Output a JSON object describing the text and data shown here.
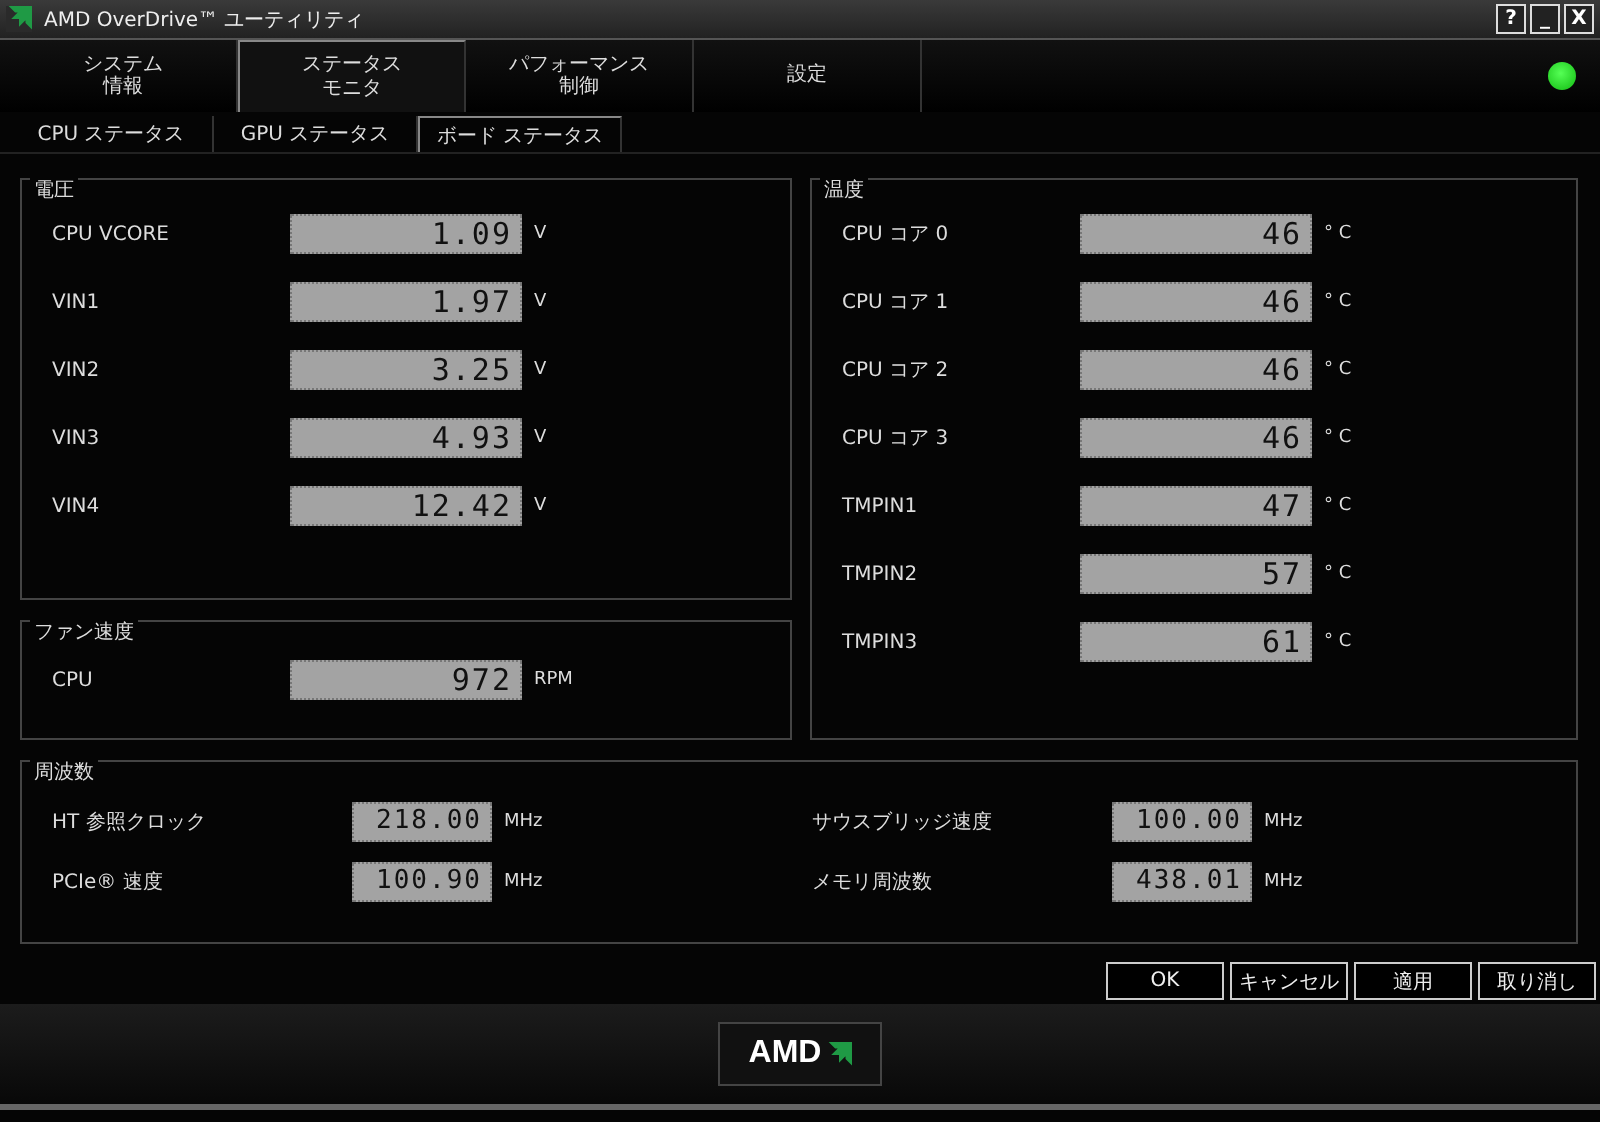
{
  "window": {
    "title": "AMD OverDrive™ ユーティリティ",
    "controls": [
      "?",
      "_",
      "X"
    ]
  },
  "tabs": [
    {
      "lines": [
        "システム",
        "情報"
      ],
      "selected": false
    },
    {
      "lines": [
        "ステータス",
        "モニタ"
      ],
      "selected": true
    },
    {
      "lines": [
        "パフォーマンス",
        "制御"
      ],
      "selected": false
    },
    {
      "lines": [
        "設定"
      ],
      "selected": false
    }
  ],
  "status_light": {
    "on": true
  },
  "subtabs": [
    {
      "label": "CPU ステータス",
      "selected": false
    },
    {
      "label": "GPU ステータス",
      "selected": false
    },
    {
      "label": "ボード ステータス",
      "selected": true
    }
  ],
  "voltage": {
    "title": "電圧",
    "rows": [
      {
        "label": "CPU VCORE",
        "value": "1.09",
        "unit": "V"
      },
      {
        "label": "VIN1",
        "value": "1.97",
        "unit": "V"
      },
      {
        "label": "VIN2",
        "value": "3.25",
        "unit": "V"
      },
      {
        "label": "VIN3",
        "value": "4.93",
        "unit": "V"
      },
      {
        "label": "VIN4",
        "value": "12.42",
        "unit": "V"
      }
    ]
  },
  "fan_speed": {
    "title": "ファン速度",
    "rows": [
      {
        "label": "CPU",
        "value": "972",
        "unit": "RPM"
      }
    ]
  },
  "temperature": {
    "title": "温度",
    "rows": [
      {
        "label": "CPU コア 0",
        "value": "46",
        "unit": "° C"
      },
      {
        "label": "CPU コア 1",
        "value": "46",
        "unit": "° C"
      },
      {
        "label": "CPU コア 2",
        "value": "46",
        "unit": "° C"
      },
      {
        "label": "CPU コア 3",
        "value": "46",
        "unit": "° C"
      },
      {
        "label": "TMPIN1",
        "value": "47",
        "unit": "° C"
      },
      {
        "label": "TMPIN2",
        "value": "57",
        "unit": "° C"
      },
      {
        "label": "TMPIN3",
        "value": "61",
        "unit": "° C"
      }
    ]
  },
  "frequency": {
    "title": "周波数",
    "rows": [
      {
        "label": "HT 参照クロック",
        "value": "218.00",
        "unit": "MHz"
      },
      {
        "label": "サウスブリッジ速度",
        "value": "100.00",
        "unit": "MHz"
      },
      {
        "label": "PCIe® 速度",
        "value": "100.90",
        "unit": "MHz"
      },
      {
        "label": "メモリ周波数",
        "value": "438.01",
        "unit": "MHz"
      }
    ]
  },
  "buttons": [
    "OK",
    "キャンセル",
    "適用",
    "取り消し"
  ],
  "footer": {
    "logo": "AMD"
  }
}
